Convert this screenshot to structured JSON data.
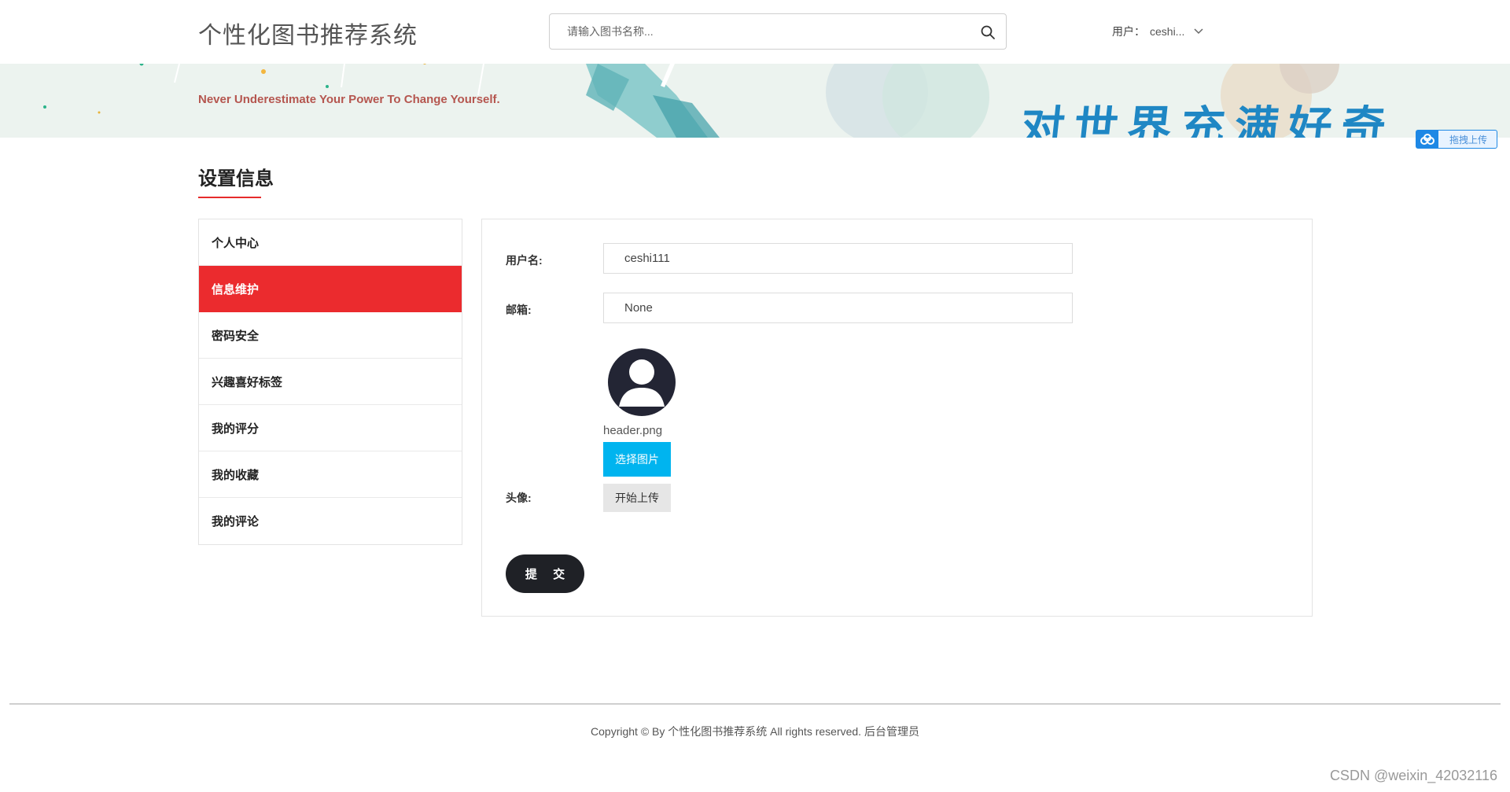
{
  "header": {
    "site_title": "个性化图书推荐系统",
    "search_placeholder": "请输入图书名称...",
    "search_icon": "search-icon",
    "user_label": "用户：",
    "user_name": "ceshi...",
    "user_dropdown_icon": "chevron-down-icon"
  },
  "banner": {
    "tagline": "Never Underestimate Your Power To Change Yourself.",
    "slogan": "对世界充满好奇",
    "upload_badge": "拖拽上传"
  },
  "section": {
    "title": "设置信息"
  },
  "sidebar": {
    "items": [
      {
        "label": "个人中心",
        "active": false
      },
      {
        "label": "信息维护",
        "active": true
      },
      {
        "label": "密码安全",
        "active": false
      },
      {
        "label": "兴趣喜好标签",
        "active": false
      },
      {
        "label": "我的评分",
        "active": false
      },
      {
        "label": "我的收藏",
        "active": false
      },
      {
        "label": "我的评论",
        "active": false
      }
    ]
  },
  "form": {
    "username_label": "用户名:",
    "username_value": "ceshi111",
    "email_label": "邮箱:",
    "email_value": "None",
    "avatar_label": "头像:",
    "avatar_filename": "header.png",
    "choose_button": "选择图片",
    "upload_button": "开始上传",
    "submit_button": "提 交"
  },
  "footer": {
    "copyright": "Copyright © By 个性化图书推荐系统 All rights reserved. 后台管理员"
  },
  "watermark": "CSDN @weixin_42032116",
  "colors": {
    "accent_red": "#eb2b2e",
    "choose_blue": "#00b4ef",
    "submit_dark": "#1f2126",
    "slogan_blue": "#1f87c4",
    "tagline_red": "#b5564f"
  }
}
